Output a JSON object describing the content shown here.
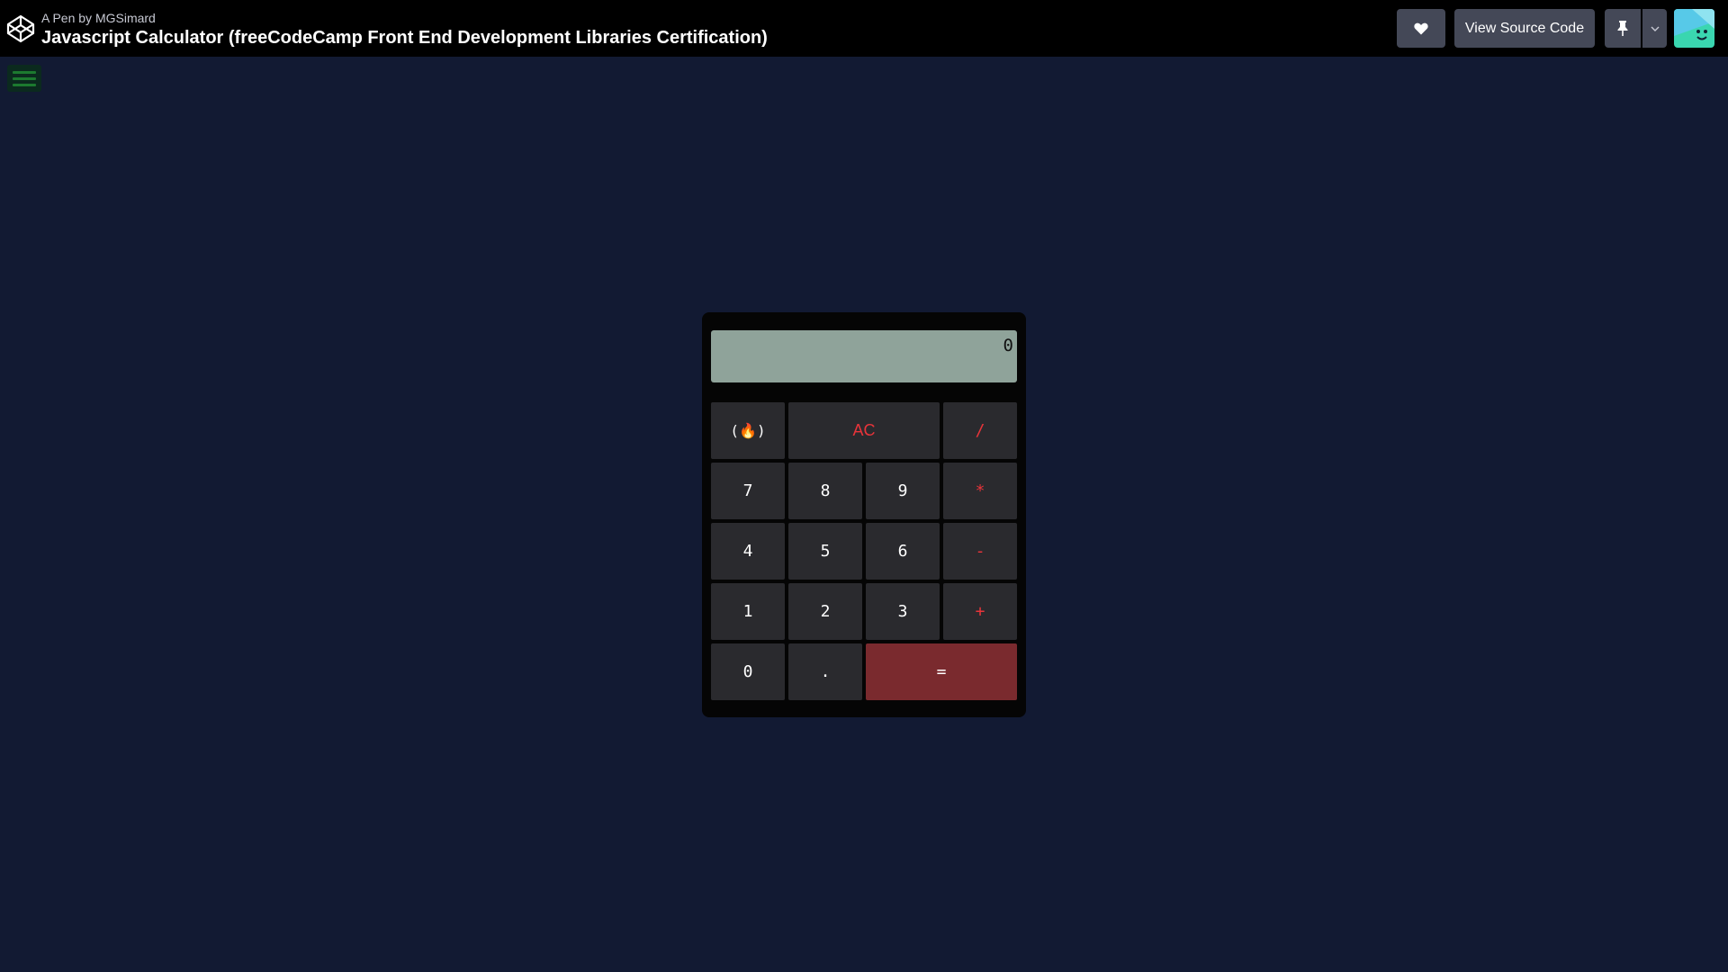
{
  "header": {
    "by_prefix": "A Pen by",
    "author": "MGSimard",
    "title": "Javascript Calculator (freeCodeCamp Front End Development Libraries Certification)",
    "view_source_label": "View Source Code"
  },
  "calculator": {
    "display": "0",
    "keys": {
      "fcc": "(🔥)",
      "ac": "AC",
      "divide": "/",
      "seven": "7",
      "eight": "8",
      "nine": "9",
      "multiply": "*",
      "four": "4",
      "five": "5",
      "six": "6",
      "subtract": "-",
      "one": "1",
      "two": "2",
      "three": "3",
      "add": "+",
      "zero": "0",
      "decimal": ".",
      "equals": "="
    }
  },
  "colors": {
    "page_bg": "#121a33",
    "header_bg": "#000000",
    "button_bg": "#444857",
    "display_bg": "#8fa39a",
    "operator": "#e8343a",
    "equals_bg": "#7a2a2e"
  },
  "icons": [
    "codepen-logo-icon",
    "heart-icon",
    "pin-icon",
    "chevron-down-icon",
    "hamburger-menu-icon",
    "avatar"
  ]
}
